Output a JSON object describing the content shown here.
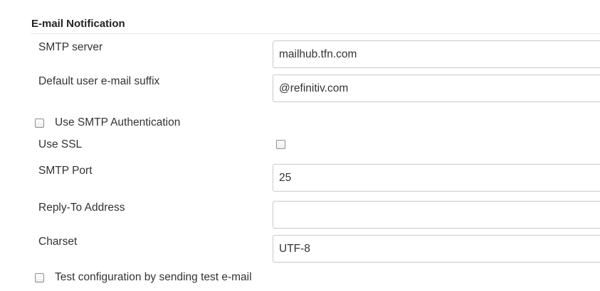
{
  "section": {
    "title": "E-mail Notification"
  },
  "smtp_server": {
    "label": "SMTP server",
    "value": "mailhub.tfn.com"
  },
  "email_suffix": {
    "label": "Default user e-mail suffix",
    "value": "@refinitiv.com"
  },
  "smtp_auth": {
    "label": "Use SMTP Authentication",
    "checked": false
  },
  "ssl": {
    "label": "Use SSL",
    "checked": false
  },
  "smtp_port": {
    "label": "SMTP Port",
    "value": "25"
  },
  "reply_to": {
    "label": "Reply-To Address",
    "value": ""
  },
  "charset": {
    "label": "Charset",
    "value": "UTF-8"
  },
  "test_config": {
    "label": "Test configuration by sending test e-mail",
    "checked": false
  }
}
